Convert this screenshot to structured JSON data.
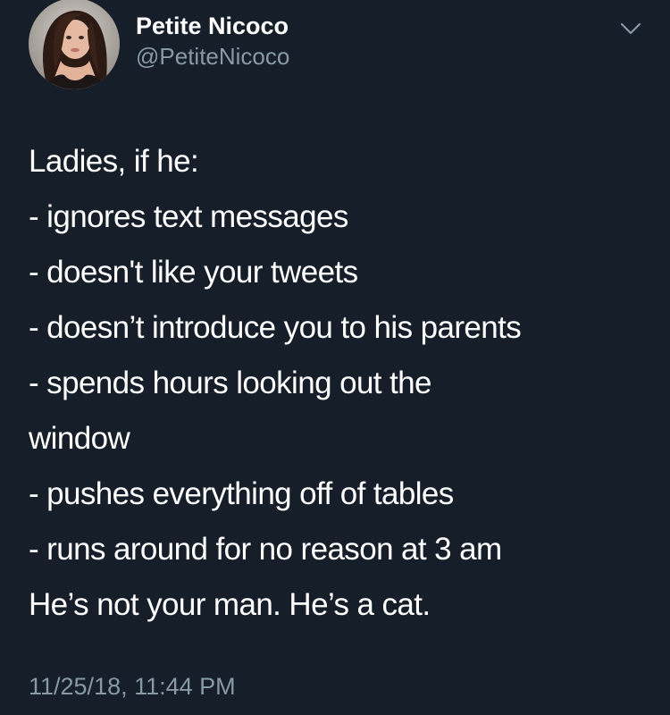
{
  "author": {
    "display_name": "Petite Nicoco",
    "handle": "@PetiteNicoco"
  },
  "tweet": {
    "intro": "Ladies, if he:",
    "lines": [
      "- ignores text messages",
      "- doesn't like your tweets",
      "- doesn’t introduce you to his parents",
      "- spends hours looking out the",
      "window",
      "- pushes everything off of tables",
      "- runs around for no reason at 3 am"
    ],
    "closing": "He’s not your man. He’s a cat.",
    "timestamp": "11/25/18, 11:44 PM"
  },
  "icons": {
    "menu": "chevron-down-icon"
  },
  "colors": {
    "background": "#151e29",
    "text": "#ffffff",
    "secondary_text": "#8899a6"
  }
}
